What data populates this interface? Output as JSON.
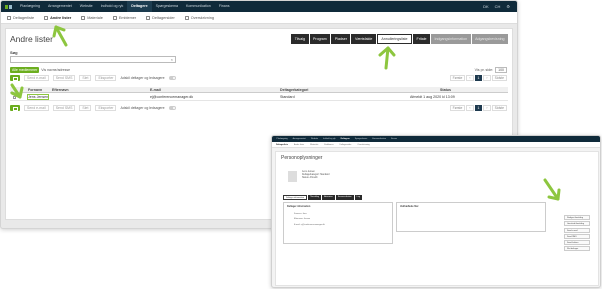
{
  "colors": {
    "nav_bg": "#0f2a3a",
    "accent_green": "#6cae1f",
    "highlight_green": "#8dc63f",
    "tab_dark": "#2b2b2b"
  },
  "main": {
    "nav": {
      "items": [
        "Planlægning",
        "Arrangementet",
        "Website",
        "Indhold og ryk",
        "Deltagere",
        "Spørgeskema",
        "Kommunikation",
        "Finans"
      ],
      "active_index": 4,
      "lang": "DK",
      "user": "CH"
    },
    "subnav": {
      "items": [
        "Deltagerliste",
        "Andre lister",
        "Materiale",
        "Emblemer",
        "Deltagersider",
        "Overskrivning"
      ],
      "active_index": 1
    },
    "title": "Andre lister",
    "tabs": {
      "items": [
        "Tilvalg",
        "Program",
        "Pladser",
        "Værtsfalde",
        "Annulleringsliste",
        "Fritale",
        "Indgangsinformation",
        "Adgangsbevisning"
      ],
      "selected_index": 4,
      "disabled_indices": [
        6,
        7
      ]
    },
    "search": {
      "label": "Søg",
      "placeholder": "",
      "clear": "×"
    },
    "filter": {
      "button": "Alle medlemmer",
      "text": "Vis navne/adresse",
      "visible_label": "Vis pr. side:",
      "visible_value": "100"
    },
    "actions": [
      "Send e-mail",
      "Send SMS",
      "Slet",
      "Eksporter"
    ],
    "toggle_label": "Adskil deltager og ledsagere",
    "pager": [
      "Første",
      "‹",
      "1",
      "›",
      "Sidste"
    ],
    "current_page": "1",
    "table": {
      "headers": [
        "Fornavn",
        "Efternavn",
        "E-mail",
        "Deltagerkategori",
        "Status"
      ],
      "rows": [
        {
          "first": "Jens Jensen",
          "last": "",
          "email": "ej@conferencemanager.dk",
          "category": "Standard",
          "status": "Afmeldt 1 aug 2020 kl 13:09"
        }
      ]
    }
  },
  "detail": {
    "nav": [
      "Planlægning",
      "Arrangementet",
      "Website",
      "Indhold og ryk",
      "Deltagere",
      "Spørgeskema",
      "Kommunikation",
      "Finans"
    ],
    "nav_active_index": 4,
    "subnav": [
      "Deltagerliste",
      "Andre lister",
      "Materiale",
      "Emblemer",
      "Deltagersider",
      "Overskrivning"
    ],
    "title": "Personoplysninger",
    "info_lines": [
      "Jens Jensen",
      "Deltagerkategori: Standard",
      "Status: Afmeldt"
    ],
    "tabs": [
      "Deltager information",
      "Tilmelding",
      "Aktiviteter",
      "Kommunikation",
      "Log"
    ],
    "box_left_title": "Deltager information",
    "fields": [
      "Fornavn: Jens",
      "Efternavn: Jensen",
      "E-mail: ej@conferencemanager.dk"
    ],
    "box_right_title": "Vedhæftede filer",
    "side_buttons": [
      "Rediger tilmelding",
      "Genskab tilmelding",
      "Send e-mail",
      "Send SMS",
      "Send faktura",
      "Slet deltager"
    ]
  }
}
